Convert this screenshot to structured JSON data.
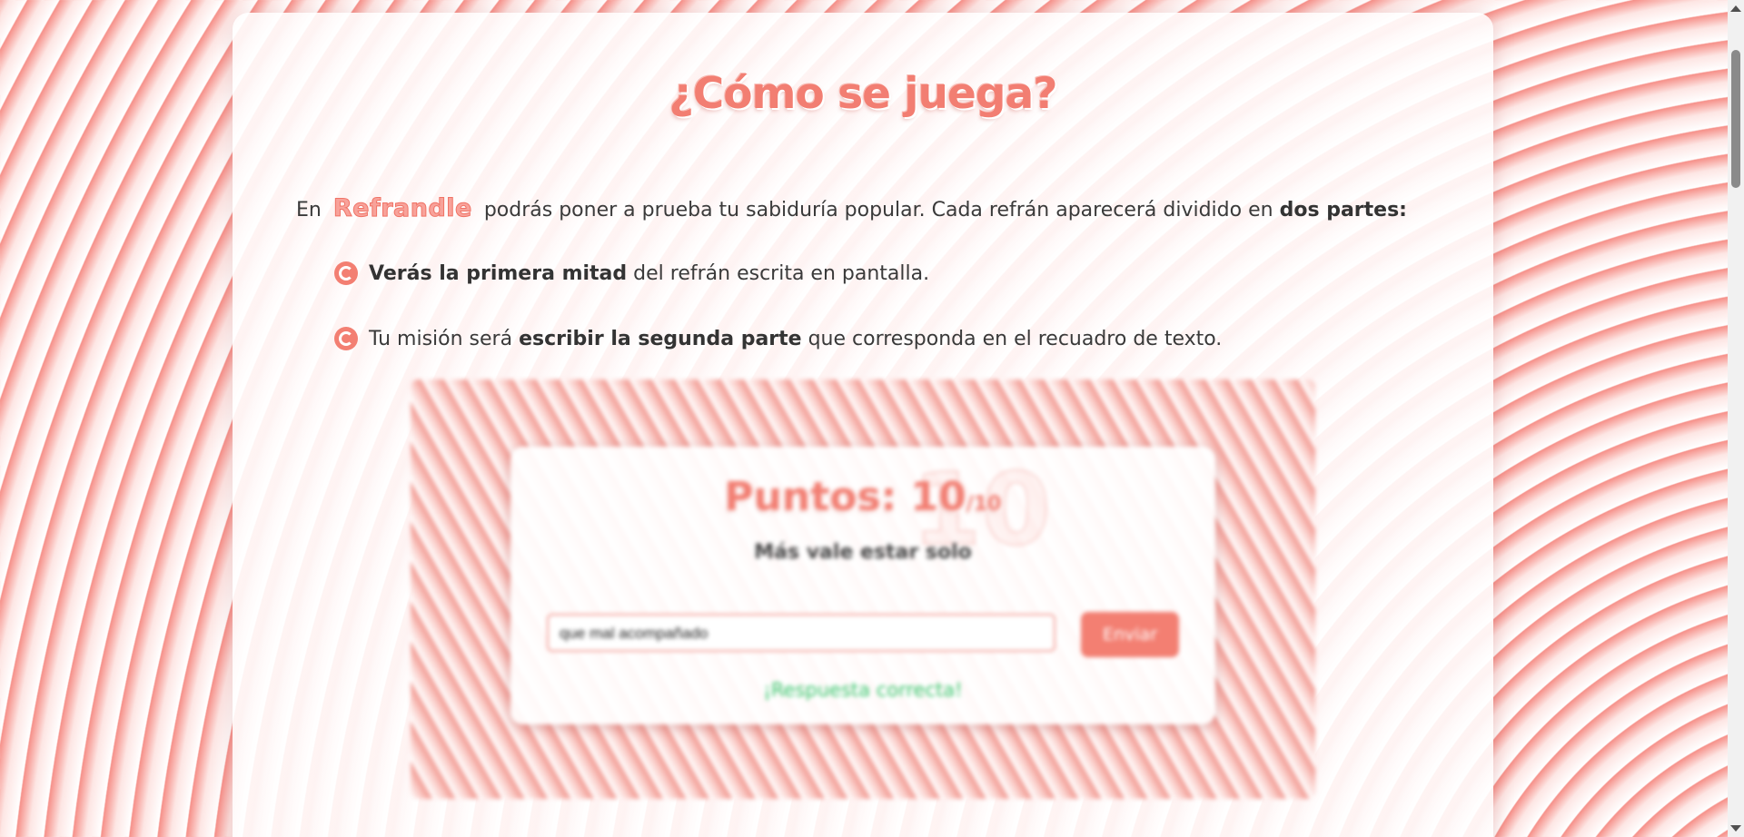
{
  "help": {
    "title": "¿Cómo se juega?",
    "intro": {
      "prefix": "En",
      "brand": "Refrandle",
      "middle": "podrás poner a prueba tu sabiduría popular. Cada refrán aparecerá dividido en",
      "bold": "dos partes:"
    },
    "bullets": [
      {
        "bold": "Verás la primera mitad",
        "text": "del refrán escrita en pantalla."
      },
      {
        "pre": "Tu misión será",
        "bold": "escribir la segunda parte",
        "text": "que corresponda en el recuadro de texto."
      }
    ]
  },
  "example": {
    "score_label": "Puntos: 10",
    "score_of": "/10",
    "ghost_score": "10",
    "phrase": "Más vale estar solo",
    "input_value": "que mal acompañado",
    "send_label": "Enviar",
    "result": "¡Respuesta correcta!"
  },
  "colors": {
    "accent": "#f37f72",
    "success": "#37c56b",
    "text": "#3a3a3a"
  },
  "icons": {
    "bullet": "swirl-bullet-icon"
  }
}
